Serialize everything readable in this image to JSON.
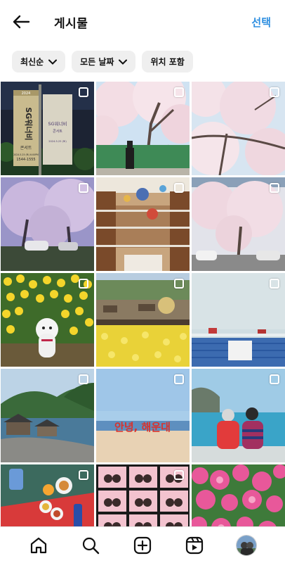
{
  "header": {
    "title": "게시물",
    "select_label": "선택",
    "accent_color": "#2f8fe0"
  },
  "filters": [
    {
      "label": "최신순",
      "has_dropdown": true
    },
    {
      "label": "모든 날짜",
      "has_dropdown": true
    },
    {
      "label": "위치 포함",
      "has_dropdown": false
    }
  ],
  "poster": {
    "year": "2024",
    "name": "SG워너비",
    "subtitle": "콘서트",
    "date": "2024.5.25 (토) 6:00PM",
    "phone": "1544-1555",
    "right_banner_name": "SG워너비",
    "right_banner_subtitle": "콘서트",
    "right_banner_date": "2024.5.25 (토)"
  },
  "beach_sign_text": "안녕, 해운대",
  "grid": {
    "photos": [
      {
        "icon": "concert-banner-photo"
      },
      {
        "icon": "cherry-blossom-photo"
      },
      {
        "icon": "cherry-blossom-photo"
      },
      {
        "icon": "cherry-blossom-night-photo"
      },
      {
        "icon": "library-interior-photo"
      },
      {
        "icon": "cherry-blossom-street-photo"
      },
      {
        "icon": "dog-in-daffodils-photo"
      },
      {
        "icon": "daffodil-field-photo"
      },
      {
        "icon": "rooftop-sea-photo"
      },
      {
        "icon": "coastal-temple-photo"
      },
      {
        "icon": "beach-sign-photo"
      },
      {
        "icon": "couple-by-sea-photo"
      },
      {
        "icon": "food-table-photo"
      },
      {
        "icon": "photo-booth-strip-photo"
      },
      {
        "icon": "azalea-flowers-photo"
      }
    ]
  },
  "bottom_nav": [
    {
      "icon": "home-icon"
    },
    {
      "icon": "search-icon"
    },
    {
      "icon": "create-icon"
    },
    {
      "icon": "reels-icon"
    },
    {
      "icon": "profile-avatar"
    }
  ]
}
